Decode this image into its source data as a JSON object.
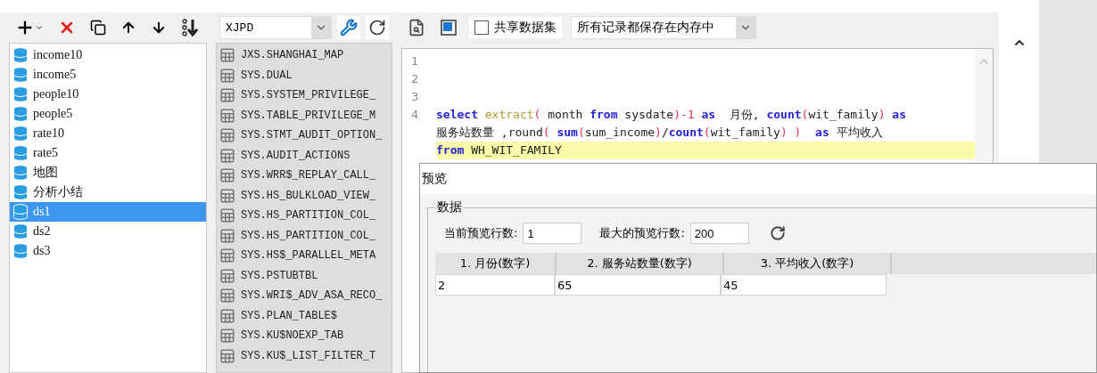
{
  "datasets": {
    "items": [
      {
        "label": "income10",
        "selected": false
      },
      {
        "label": "income5",
        "selected": false
      },
      {
        "label": "people10",
        "selected": false
      },
      {
        "label": "people5",
        "selected": false
      },
      {
        "label": "rate10",
        "selected": false
      },
      {
        "label": "rate5",
        "selected": false
      },
      {
        "label": "地图",
        "selected": false
      },
      {
        "label": "分析小结",
        "selected": false
      },
      {
        "label": "ds1",
        "selected": true
      },
      {
        "label": "ds2",
        "selected": false
      },
      {
        "label": "ds3",
        "selected": false
      }
    ]
  },
  "tables": {
    "schema": "XJPD",
    "items": [
      "JXS.SHANGHAI_MAP",
      "SYS.DUAL",
      "SYS.SYSTEM_PRIVILEGE_",
      "SYS.TABLE_PRIVILEGE_M",
      "SYS.STMT_AUDIT_OPTION_",
      "SYS.AUDIT_ACTIONS",
      "SYS.WRR$_REPLAY_CALL_",
      "SYS.HS_BULKLOAD_VIEW_",
      "SYS.HS_PARTITION_COL_",
      "SYS.HS_PARTITION_COL_",
      "SYS.HS$_PARALLEL_META",
      "SYS.PSTUBTBL",
      "SYS.WRI$_ADV_ASA_RECO_",
      "SYS.PLAN_TABLE$",
      "SYS.KU$NOEXP_TAB",
      "SYS.KU$_LIST_FILTER_T"
    ]
  },
  "editor": {
    "share_dataset": {
      "label": "共享数据集",
      "checked": false
    },
    "storage_mode": "所有记录都保存在内存中",
    "rows": [
      {
        "number": "1",
        "highlighted": false
      },
      {
        "number": "2",
        "highlighted": false
      },
      {
        "number": "3",
        "highlighted": false
      },
      {
        "number": "4",
        "highlighted": false,
        "tokens": [
          {
            "kind": "keyword",
            "text": "select "
          },
          {
            "kind": "function",
            "text": "extract"
          },
          {
            "kind": "paren",
            "text": "("
          },
          {
            "kind": "plain",
            "text": " month "
          },
          {
            "kind": "keyword",
            "text": "from"
          },
          {
            "kind": "plain",
            "text": " sysdate"
          },
          {
            "kind": "paren",
            "text": ")-1"
          },
          {
            "kind": "keyword",
            "text": " as"
          },
          {
            "kind": "plain",
            "text": "  月份, "
          },
          {
            "kind": "keyword",
            "text": "count"
          },
          {
            "kind": "paren",
            "text": "("
          },
          {
            "kind": "plain",
            "text": "wit_family"
          },
          {
            "kind": "paren",
            "text": ")"
          },
          {
            "kind": "keyword",
            "text": " as"
          }
        ]
      },
      {
        "highlighted": false,
        "tokens": [
          {
            "kind": "plain",
            "text": "服务站数量 ,round"
          },
          {
            "kind": "paren",
            "text": "("
          },
          {
            "kind": "keyword",
            "text": " sum"
          },
          {
            "kind": "paren",
            "text": "("
          },
          {
            "kind": "plain",
            "text": "sum_income"
          },
          {
            "kind": "paren",
            "text": ")"
          },
          {
            "kind": "plain",
            "text": "/"
          },
          {
            "kind": "keyword",
            "text": "count"
          },
          {
            "kind": "paren",
            "text": "("
          },
          {
            "kind": "plain",
            "text": "wit_family"
          },
          {
            "kind": "paren",
            "text": ") )"
          },
          {
            "kind": "keyword",
            "text": "  as"
          },
          {
            "kind": "plain",
            "text": " 平均收入"
          }
        ]
      },
      {
        "highlighted": true,
        "tokens": [
          {
            "kind": "keyword",
            "text": "from"
          },
          {
            "kind": "plain",
            "text": " WH_WIT_FAMILY"
          }
        ]
      }
    ]
  },
  "preview": {
    "title": "预览",
    "group": "数据",
    "current_rows_label": "当前预览行数:",
    "current_rows": "1",
    "max_rows_label": "最大的预览行数:",
    "max_rows": "200",
    "columns": [
      "1. 月份(数字)",
      "2. 服务站数量(数字)",
      "3. 平均收入(数字)"
    ],
    "rows": [
      [
        "2",
        "65",
        "45"
      ]
    ]
  }
}
